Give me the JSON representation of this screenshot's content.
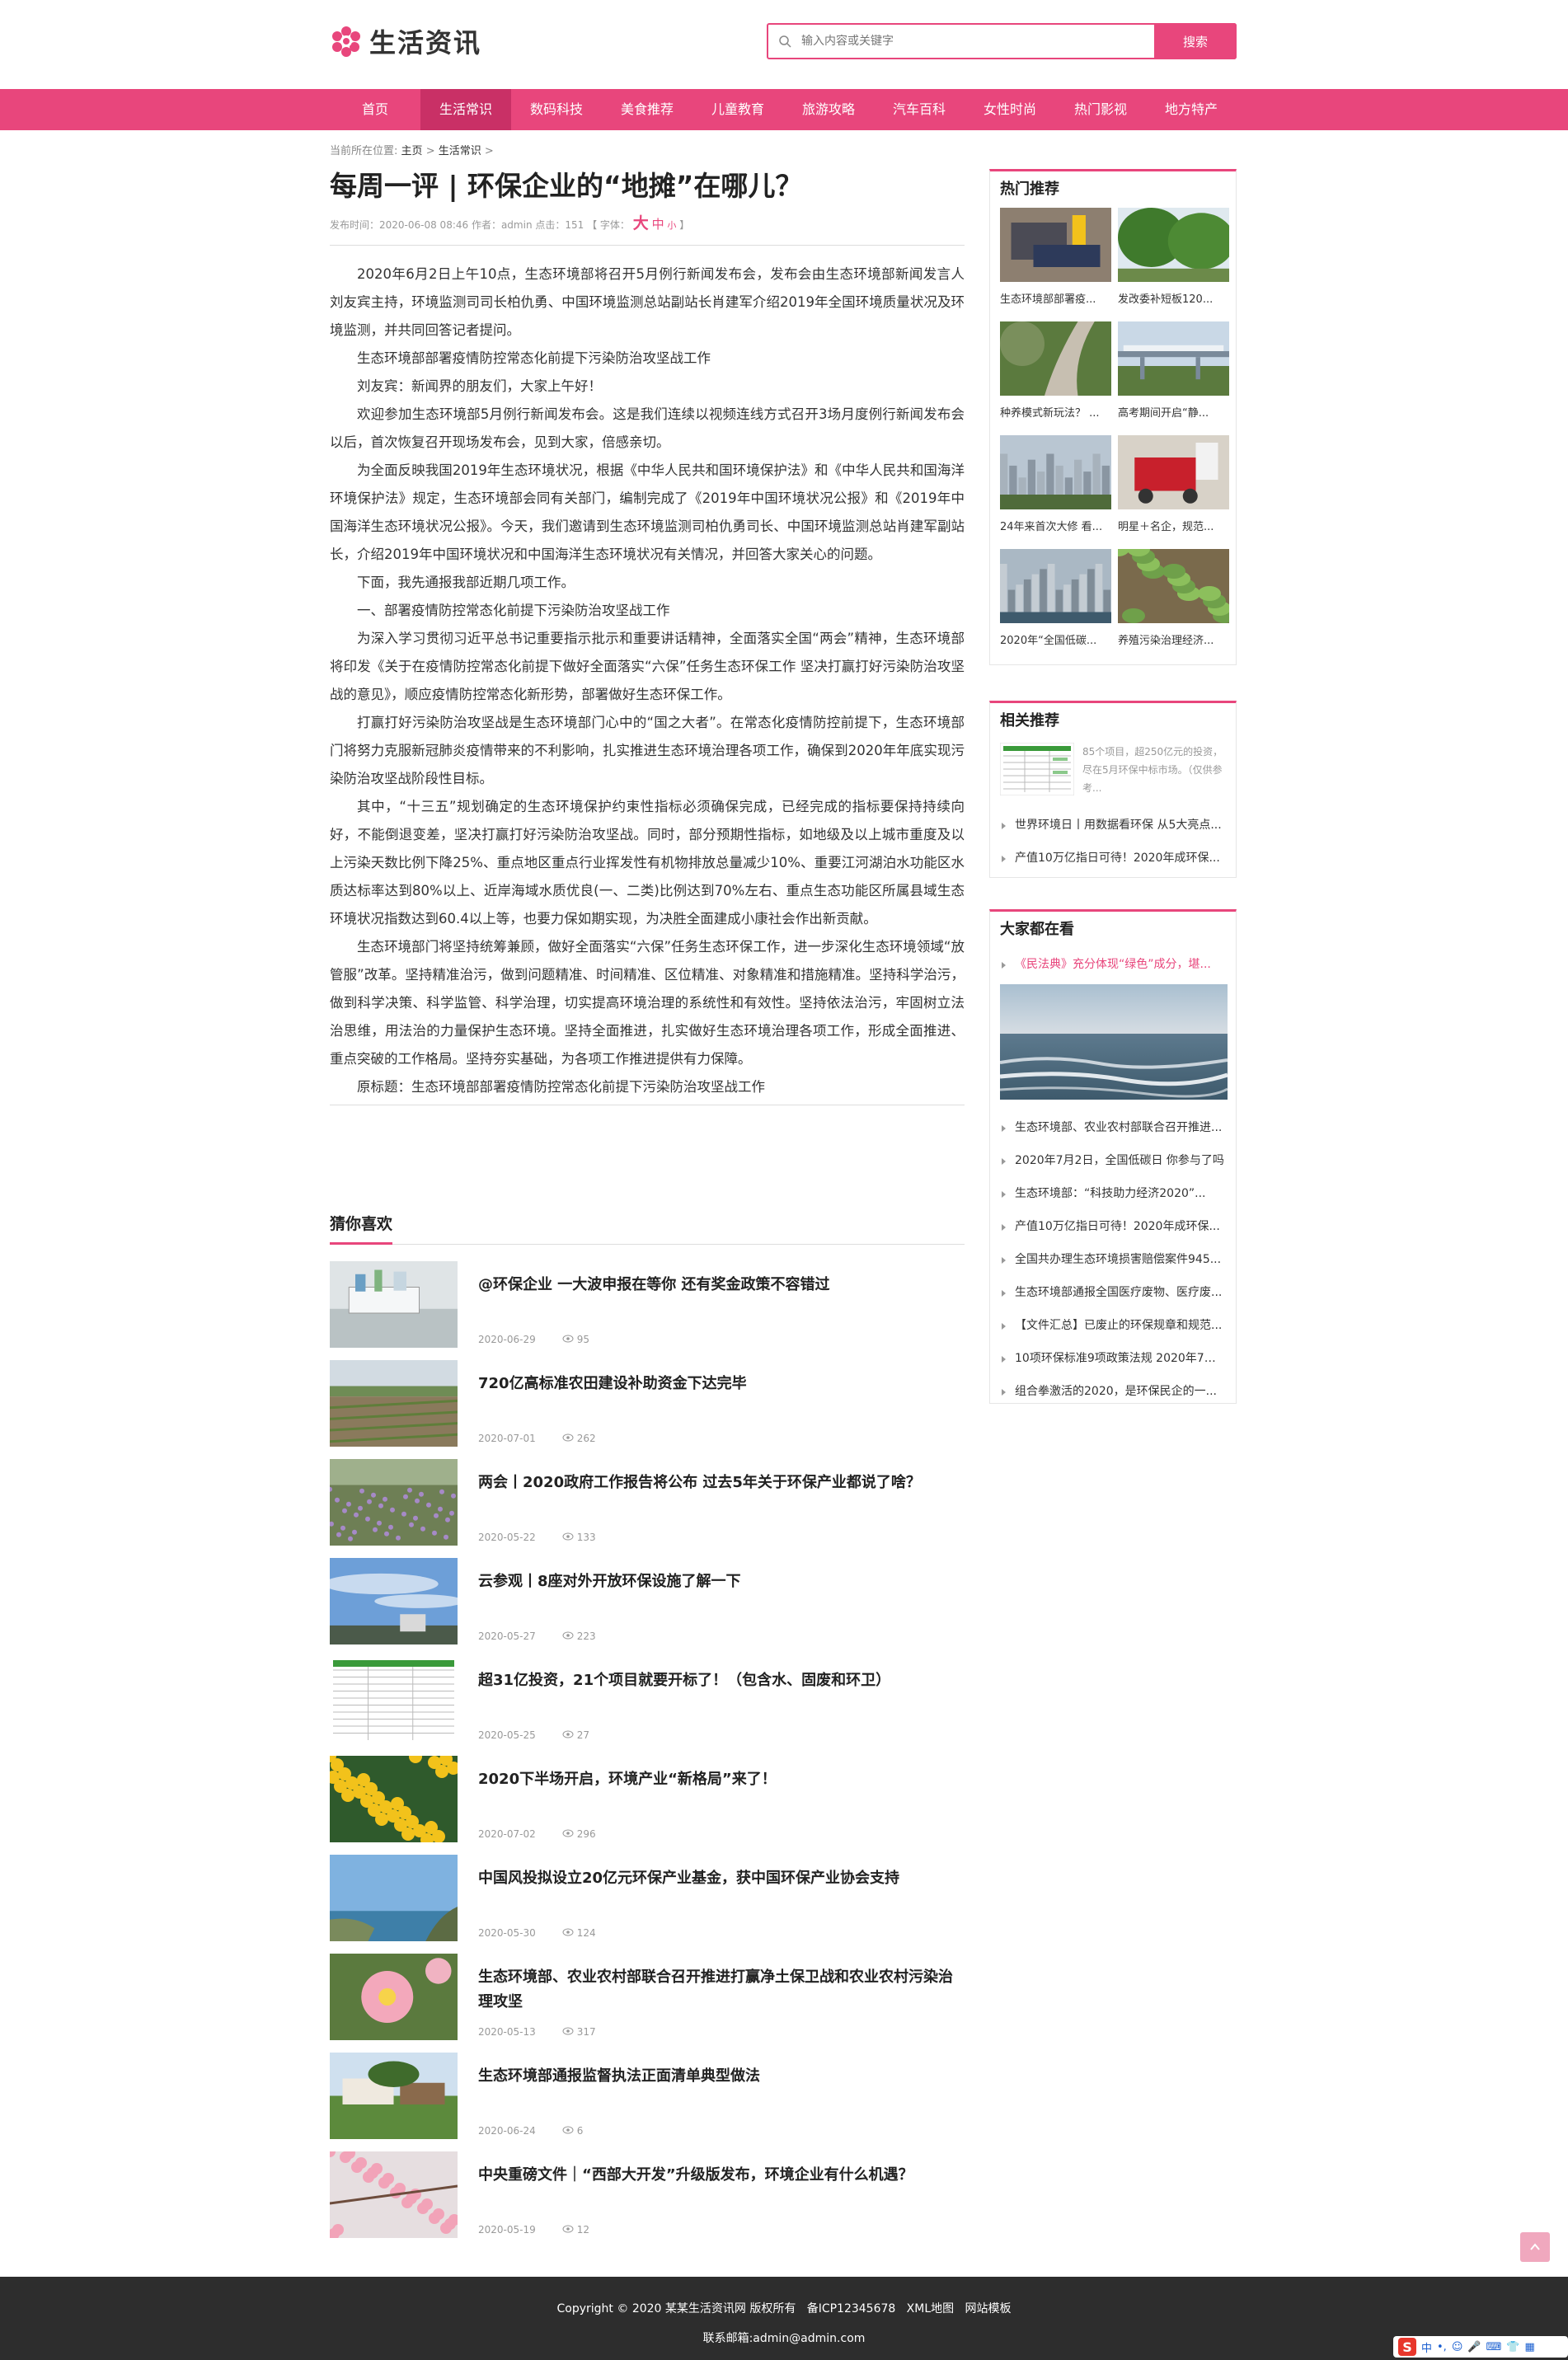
{
  "site": {
    "name": "生活资讯"
  },
  "search": {
    "placeholder": "输入内容或关键字",
    "button": "搜索"
  },
  "nav": [
    "首页",
    "生活常识",
    "数码科技",
    "美食推荐",
    "儿童教育",
    "旅游攻略",
    "汽车百科",
    "女性时尚",
    "热门影视",
    "地方特产"
  ],
  "nav_active": "生活常识",
  "breadcrumb": {
    "prefix": "当前所在位置:",
    "home": "主页",
    "sep1": ">",
    "current": "生活常识",
    "sep2": ">"
  },
  "article": {
    "title": "每周一评 | 环保企业的“地摊”在哪儿？",
    "meta": "发布时间：2020-06-08 08:46 作者：admin 点击：151 【 字体：",
    "font_big": "大",
    "font_mid": "中",
    "font_small": "小",
    "meta_end": "】",
    "paragraphs": [
      "2020年6月2日上午10点，生态环境部将召开5月例行新闻发布会，发布会由生态环境部新闻发言人刘友宾主持，环境监测司司长柏仇勇、中国环境监测总站副站长肖建军介绍2019年全国环境质量状况及环境监测，并共同回答记者提问。",
      "生态环境部部署疫情防控常态化前提下污染防治攻坚战工作",
      "刘友宾：新闻界的朋友们，大家上午好！",
      "欢迎参加生态环境部5月例行新闻发布会。这是我们连续以视频连线方式召开3场月度例行新闻发布会以后，首次恢复召开现场发布会，见到大家，倍感亲切。",
      "为全面反映我国2019年生态环境状况，根据《中华人民共和国环境保护法》和《中华人民共和国海洋环境保护法》规定，生态环境部会同有关部门，编制完成了《2019年中国环境状况公报》和《2019年中国海洋生态环境状况公报》。今天，我们邀请到生态环境监测司柏仇勇司长、中国环境监测总站肖建军副站长，介绍2019年中国环境状况和中国海洋生态环境状况有关情况，并回答大家关心的问题。",
      "下面，我先通报我部近期几项工作。",
      "一、部署疫情防控常态化前提下污染防治攻坚战工作",
      "为深入学习贯彻习近平总书记重要指示批示和重要讲话精神，全面落实全国“两会”精神，生态环境部将印发《关于在疫情防控常态化前提下做好全面落实“六保”任务生态环保工作 坚决打赢打好污染防治攻坚战的意见》，顺应疫情防控常态化新形势，部署做好生态环保工作。",
      "打赢打好污染防治攻坚战是生态环境部门心中的“国之大者”。在常态化疫情防控前提下，生态环境部门将努力克服新冠肺炎疫情带来的不利影响，扎实推进生态环境治理各项工作，确保到2020年年底实现污染防治攻坚战阶段性目标。",
      "其中，“十三五”规划确定的生态环境保护约束性指标必须确保完成，已经完成的指标要保持持续向好，不能倒退变差，坚决打赢打好污染防治攻坚战。同时，部分预期性指标，如地级及以上城市重度及以上污染天数比例下降25%、重点地区重点行业挥发性有机物排放总量减少10%、重要江河湖泊水功能区水质达标率达到80%以上、近岸海域水质优良(一、二类)比例达到70%左右、重点生态功能区所属县域生态环境状况指数达到60.4以上等，也要力保如期实现，为决胜全面建成小康社会作出新贡献。",
      "生态环境部门将坚持统筹兼顾，做好全面落实“六保”任务生态环保工作，进一步深化生态环境领域“放管服”改革。坚持精准治污，做到问题精准、时间精准、区位精准、对象精准和措施精准。坚持科学治污，做到科学决策、科学监管、科学治理，切实提高环境治理的系统性和有效性。坚持依法治污，牢固树立法治思维，用法治的力量保护生态环境。坚持全面推进，扎实做好生态环境治理各项工作，形成全面推进、重点突破的工作格局。坚持夯实基础，为各项工作推进提供有力保障。",
      "原标题：生态环境部部署疫情防控常态化前提下污染防治攻坚战工作"
    ]
  },
  "guess": {
    "title": "猜你喜欢",
    "items": [
      {
        "title": "@环保企业 一大波申报在等你 还有奖金政策不容错过",
        "date": "2020-06-29",
        "views": "95",
        "img": "lab"
      },
      {
        "title": "720亿高标准农田建设补助资金下达完毕",
        "date": "2020-07-01",
        "views": "262",
        "img": "field"
      },
      {
        "title": "两会丨2020政府工作报告将公布 过去5年关于环保产业都说了啥？",
        "date": "2020-05-22",
        "views": "133",
        "img": "lavender"
      },
      {
        "title": "云参观丨8座对外开放环保设施了解一下",
        "date": "2020-05-27",
        "views": "223",
        "img": "sky"
      },
      {
        "title": "超31亿投资，21个项目就要开标了！（包含水、固废和环卫）",
        "date": "2020-05-25",
        "views": "27",
        "img": "table"
      },
      {
        "title": "2020下半场开启，环境产业“新格局”来了！",
        "date": "2020-07-02",
        "views": "296",
        "img": "flowers"
      },
      {
        "title": "中国风投拟设立20亿元环保产业基金，获中国环保产业协会支持",
        "date": "2020-05-30",
        "views": "124",
        "img": "coast"
      },
      {
        "title": "生态环境部、农业农村部联合召开推进打赢净土保卫战和农业农村污染治理攻坚",
        "date": "2020-05-13",
        "views": "317",
        "img": "rose"
      },
      {
        "title": "生态环境部通报监督执法正面清单典型做法",
        "date": "2020-06-24",
        "views": "6",
        "img": "park"
      },
      {
        "title": "中央重磅文件｜“西部大开发”升级版发布，环境企业有什么机遇？",
        "date": "2020-05-19",
        "views": "12",
        "img": "blossom"
      }
    ]
  },
  "hot": {
    "title": "热门推荐",
    "items": [
      {
        "caption": "生态环境部部署疫...",
        "img": "workers"
      },
      {
        "caption": "发改委补短板120...",
        "img": "trees"
      },
      {
        "caption": "种养模式新玩法？ ...",
        "img": "path"
      },
      {
        "caption": "高考期间开启“静...",
        "img": "bridge"
      },
      {
        "caption": "24年来首次大修 看...",
        "img": "city"
      },
      {
        "caption": "明星＋名企，规范...",
        "img": "scooter"
      },
      {
        "caption": "2020年“全国低碳...",
        "img": "hk"
      },
      {
        "caption": "养殖污染治理经济...",
        "img": "plant"
      }
    ]
  },
  "related": {
    "title": "相关推荐",
    "top_desc": "85个项目，超250亿元的投资，尽在5月环保中标市场。（仅供参考...",
    "items": [
      "世界环境日丨用数据看环保 从5大亮点...",
      "产值10万亿指日可待！2020年成环保..."
    ]
  },
  "popular": {
    "title": "大家都在看",
    "first": "《民法典》充分体现“绿色”成分，堪...",
    "items": [
      "生态环境部、农业农村部联合召开推进...",
      "2020年7月2日，全国低碳日 你参与了吗",
      "生态环境部：“科技助力经济2020”...",
      "产值10万亿指日可待！2020年成环保...",
      "全国共办理生态环境损害赔偿案件945...",
      "生态环境部通报全国医疗废物、医疗废...",
      "【文件汇总】已废止的环保规章和规范...",
      "10项环保标准9项政策法规 2020年7月...",
      "组合拳激活的2020，是环保民企的一..."
    ]
  },
  "footer": {
    "line1": "Copyright © 2020 某某生活资讯网 版权所有   备ICP12345678   XML地图   网站模板",
    "line2": "联系邮箱:admin@admin.com"
  },
  "ime": {
    "label": "中"
  },
  "colors": {
    "accent": "#e8467c",
    "footer": "#2d2d2d"
  }
}
